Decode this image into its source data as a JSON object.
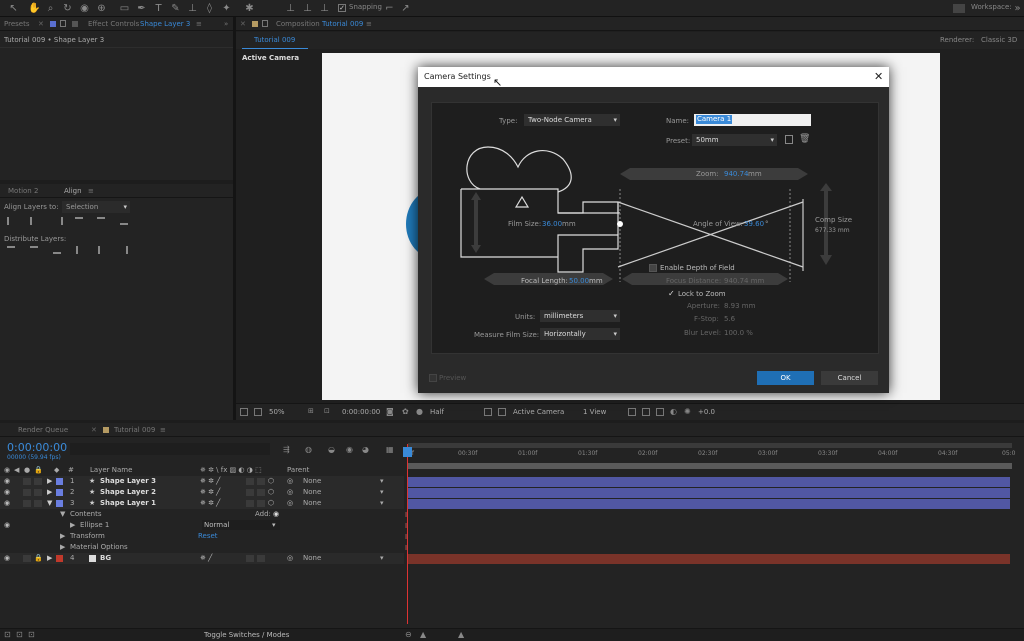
{
  "topbar": {
    "snapping": "Snapping",
    "workspace_label": "Workspace:"
  },
  "left_panel": {
    "presets_tab": "Presets",
    "effect_controls_tab": "Effect Controls",
    "effect_controls_layer": "Shape Layer 3",
    "subtitle": "Tutorial 009 • Shape Layer 3"
  },
  "align_panel": {
    "motion_tab": "Motion 2",
    "align_tab": "Align",
    "align_to_label": "Align Layers to:",
    "align_to_value": "Selection",
    "distribute_label": "Distribute Layers:"
  },
  "comp_panel": {
    "tab_label": "Composition",
    "comp_name": "Tutorial 009",
    "subtab": "Tutorial 009",
    "renderer_label": "Renderer:",
    "renderer_value": "Classic 3D",
    "active_camera": "Active Camera",
    "footer": {
      "zoom": "50%",
      "timecode": "0:00:00:00",
      "resolution": "Half",
      "view": "Active Camera",
      "view_count": "1 View",
      "exposure": "+0.0"
    }
  },
  "dialog": {
    "title": "Camera Settings",
    "type_label": "Type:",
    "type_value": "Two-Node Camera",
    "name_label": "Name:",
    "name_value": "Camera 1",
    "preset_label": "Preset:",
    "preset_value": "50mm",
    "zoom_label": "Zoom:",
    "zoom_value": "940.74",
    "zoom_unit": "mm",
    "film_size_label": "Film Size:",
    "film_size_value": "36.00",
    "film_size_unit": "mm",
    "angle_label": "Angle of View:",
    "angle_value": "39.60",
    "angle_unit": "°",
    "comp_size_label": "Comp Size",
    "comp_size_value": "677.33 mm",
    "focal_length_label": "Focal Length:",
    "focal_length_value": "50.00",
    "focal_length_unit": "mm",
    "dof_label": "Enable Depth of Field",
    "focus_distance_label": "Focus Distance:",
    "focus_distance_value": "940.74 mm",
    "lock_to_zoom_label": "Lock to Zoom",
    "aperture_label": "Aperture:",
    "aperture_value": "8.93 mm",
    "fstop_label": "F-Stop:",
    "fstop_value": "5.6",
    "blur_label": "Blur Level:",
    "blur_value": "100.0 %",
    "units_label": "Units:",
    "units_value": "millimeters",
    "measure_label": "Measure Film Size:",
    "measure_value": "Horizontally",
    "preview_label": "Preview",
    "ok": "OK",
    "cancel": "Cancel"
  },
  "timeline": {
    "render_queue_tab": "Render Queue",
    "comp_tab": "Tutorial 009",
    "timecode": "0:00:00:00",
    "fps": "00000 (59.94 fps)",
    "col_layer_name": "Layer Name",
    "col_parent": "Parent",
    "layers": [
      {
        "num": "1",
        "name": "Shape Layer 3",
        "parent": "None"
      },
      {
        "num": "2",
        "name": "Shape Layer 2",
        "parent": "None"
      },
      {
        "num": "3",
        "name": "Shape Layer 1",
        "parent": "None"
      },
      {
        "num": "4",
        "name": "BG",
        "parent": "None"
      }
    ],
    "contents_label": "Contents",
    "add_label": "Add:",
    "ellipse_label": "Ellipse 1",
    "blend_mode": "Normal",
    "transform_label": "Transform",
    "reset_label": "Reset",
    "material_label": "Material Options",
    "ruler": [
      "0f",
      "00:30f",
      "01:00f",
      "01:30f",
      "02:00f",
      "02:30f",
      "03:00f",
      "03:30f",
      "04:00f",
      "04:30f",
      "05:0"
    ],
    "toggle_label": "Toggle Switches / Modes"
  }
}
